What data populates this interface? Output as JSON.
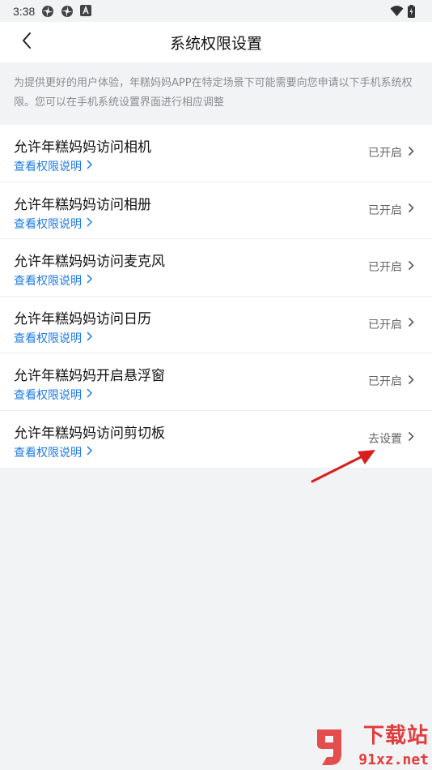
{
  "status_bar": {
    "time": "3:38",
    "icons_left": [
      "photos-pinwheel-icon",
      "photos-pinwheel-icon",
      "a-box-icon"
    ],
    "icons_right": [
      "wifi-icon",
      "battery-charging-icon"
    ]
  },
  "nav": {
    "title": "系统权限设置",
    "back_icon": "chevron-left-icon"
  },
  "notice": {
    "text": "为提供更好的用户体验，年糕妈妈APP在特定场景下可能需要向您申请以下手机系统权限。您可以在手机系统设置界面进行相应调整"
  },
  "permissions": [
    {
      "title": "允许年糕妈妈访问相机",
      "link": "查看权限说明",
      "status": "已开启"
    },
    {
      "title": "允许年糕妈妈访问相册",
      "link": "查看权限说明",
      "status": "已开启"
    },
    {
      "title": "允许年糕妈妈访问麦克风",
      "link": "查看权限说明",
      "status": "已开启"
    },
    {
      "title": "允许年糕妈妈访问日历",
      "link": "查看权限说明",
      "status": "已开启"
    },
    {
      "title": "允许年糕妈妈开启悬浮窗",
      "link": "查看权限说明",
      "status": "已开启"
    },
    {
      "title": "允许年糕妈妈访问剪切板",
      "link": "查看权限说明",
      "status": "去设置"
    }
  ],
  "watermark": {
    "line1": "下载站",
    "line2": "91xz.net"
  },
  "colors": {
    "link": "#1e7be6",
    "background": "#f2f3f5",
    "annotation_arrow": "#e02020",
    "watermark": "#e23b3b"
  }
}
